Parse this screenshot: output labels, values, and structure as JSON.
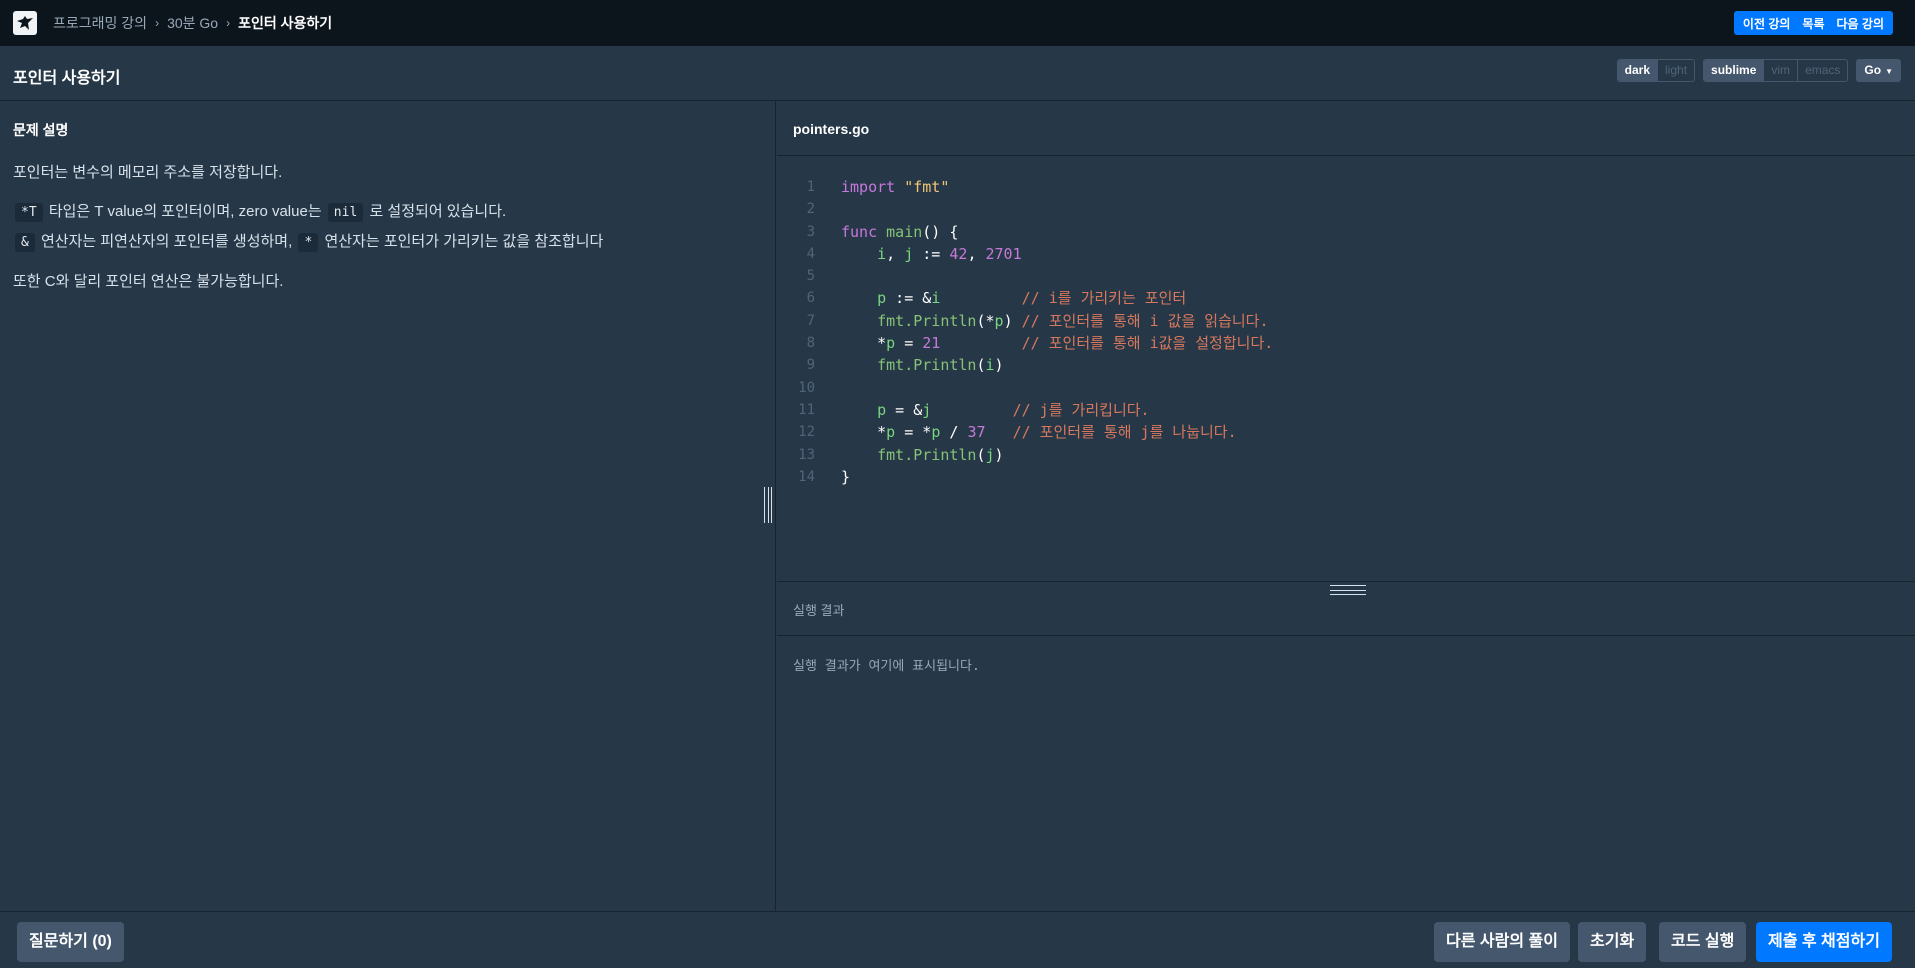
{
  "nav": {
    "breadcrumbs": [
      "프로그래밍 강의",
      "30분 Go",
      "포인터 사용하기"
    ],
    "prev_label": "이전 강의",
    "list_label": "목록",
    "next_label": "다음 강의"
  },
  "header": {
    "title": "포인터 사용하기",
    "theme_options": [
      "dark",
      "light"
    ],
    "theme_selected": "dark",
    "keymap_options": [
      "sublime",
      "vim",
      "emacs"
    ],
    "keymap_selected": "sublime",
    "language": "Go"
  },
  "description": {
    "heading": "문제 설명",
    "p1": "포인터는 변수의 메모리 주소를 저장합니다.",
    "p2_code1": "*T",
    "p2_text1": "타입은 T value의 포인터이며, zero value는",
    "p2_code2": "nil",
    "p2_text2": "로 설정되어 있습니다.",
    "p3_code1": "&",
    "p3_text1": "연산자는 피연산자의 포인터를 생성하며,",
    "p3_code2": "*",
    "p3_text2": "연산자는 포인터가 가리키는 값을 참조합니다",
    "p4": "또한 C와 달리 포인터 연산은 불가능합니다."
  },
  "editor": {
    "filename": "pointers.go",
    "line_numbers": [
      "1",
      "2",
      "3",
      "4",
      "5",
      "6",
      "7",
      "8",
      "9",
      "10",
      "11",
      "12",
      "13",
      "14"
    ],
    "lines": [
      [
        {
          "t": "k",
          "v": "import"
        },
        {
          "t": "p",
          "v": " "
        },
        {
          "t": "s",
          "v": "\"fmt\""
        }
      ],
      [],
      [
        {
          "t": "k",
          "v": "func"
        },
        {
          "t": "p",
          "v": " "
        },
        {
          "t": "f",
          "v": "main"
        },
        {
          "t": "p",
          "v": "() {"
        }
      ],
      [
        {
          "t": "p",
          "v": "    "
        },
        {
          "t": "v",
          "v": "i"
        },
        {
          "t": "p",
          "v": ", "
        },
        {
          "t": "v",
          "v": "j"
        },
        {
          "t": "p",
          "v": " := "
        },
        {
          "t": "n",
          "v": "42"
        },
        {
          "t": "p",
          "v": ", "
        },
        {
          "t": "n",
          "v": "2701"
        }
      ],
      [],
      [
        {
          "t": "p",
          "v": "    "
        },
        {
          "t": "v",
          "v": "p"
        },
        {
          "t": "p",
          "v": " := &"
        },
        {
          "t": "v",
          "v": "i"
        },
        {
          "t": "p",
          "v": "         "
        },
        {
          "t": "c",
          "v": "// i를 가리키는 포인터"
        }
      ],
      [
        {
          "t": "p",
          "v": "    "
        },
        {
          "t": "f",
          "v": "fmt.Println"
        },
        {
          "t": "p",
          "v": "(*"
        },
        {
          "t": "v",
          "v": "p"
        },
        {
          "t": "p",
          "v": ") "
        },
        {
          "t": "c",
          "v": "// 포인터를 통해 i 값을 읽습니다."
        }
      ],
      [
        {
          "t": "p",
          "v": "    *"
        },
        {
          "t": "v",
          "v": "p"
        },
        {
          "t": "p",
          "v": " = "
        },
        {
          "t": "n",
          "v": "21"
        },
        {
          "t": "p",
          "v": "         "
        },
        {
          "t": "c",
          "v": "// 포인터를 통해 i값을 설정합니다."
        }
      ],
      [
        {
          "t": "p",
          "v": "    "
        },
        {
          "t": "f",
          "v": "fmt.Println"
        },
        {
          "t": "p",
          "v": "("
        },
        {
          "t": "v",
          "v": "i"
        },
        {
          "t": "p",
          "v": ")"
        }
      ],
      [],
      [
        {
          "t": "p",
          "v": "    "
        },
        {
          "t": "v",
          "v": "p"
        },
        {
          "t": "p",
          "v": " = &"
        },
        {
          "t": "v",
          "v": "j"
        },
        {
          "t": "p",
          "v": "         "
        },
        {
          "t": "c",
          "v": "// j를 가리킵니다."
        }
      ],
      [
        {
          "t": "p",
          "v": "    *"
        },
        {
          "t": "v",
          "v": "p"
        },
        {
          "t": "p",
          "v": " = *"
        },
        {
          "t": "v",
          "v": "p"
        },
        {
          "t": "p",
          "v": " / "
        },
        {
          "t": "n",
          "v": "37"
        },
        {
          "t": "p",
          "v": "   "
        },
        {
          "t": "c",
          "v": "// 포인터를 통해 j를 나눕니다."
        }
      ],
      [
        {
          "t": "p",
          "v": "    "
        },
        {
          "t": "f",
          "v": "fmt.Println"
        },
        {
          "t": "p",
          "v": "("
        },
        {
          "t": "v",
          "v": "j"
        },
        {
          "t": "p",
          "v": ")"
        }
      ],
      [
        {
          "t": "p",
          "v": "}"
        }
      ]
    ]
  },
  "output": {
    "heading": "실행 결과",
    "placeholder": "실행 결과가 여기에 표시됩니다."
  },
  "footer": {
    "question_label": "질문하기 (0)",
    "others_label": "다른 사람의 풀이",
    "reset_label": "초기화",
    "run_label": "코드 실행",
    "submit_label": "제출 후 채점하기"
  },
  "colors": {
    "accent": "#0078ff",
    "background": "#263747",
    "topbar": "#0c151c"
  }
}
